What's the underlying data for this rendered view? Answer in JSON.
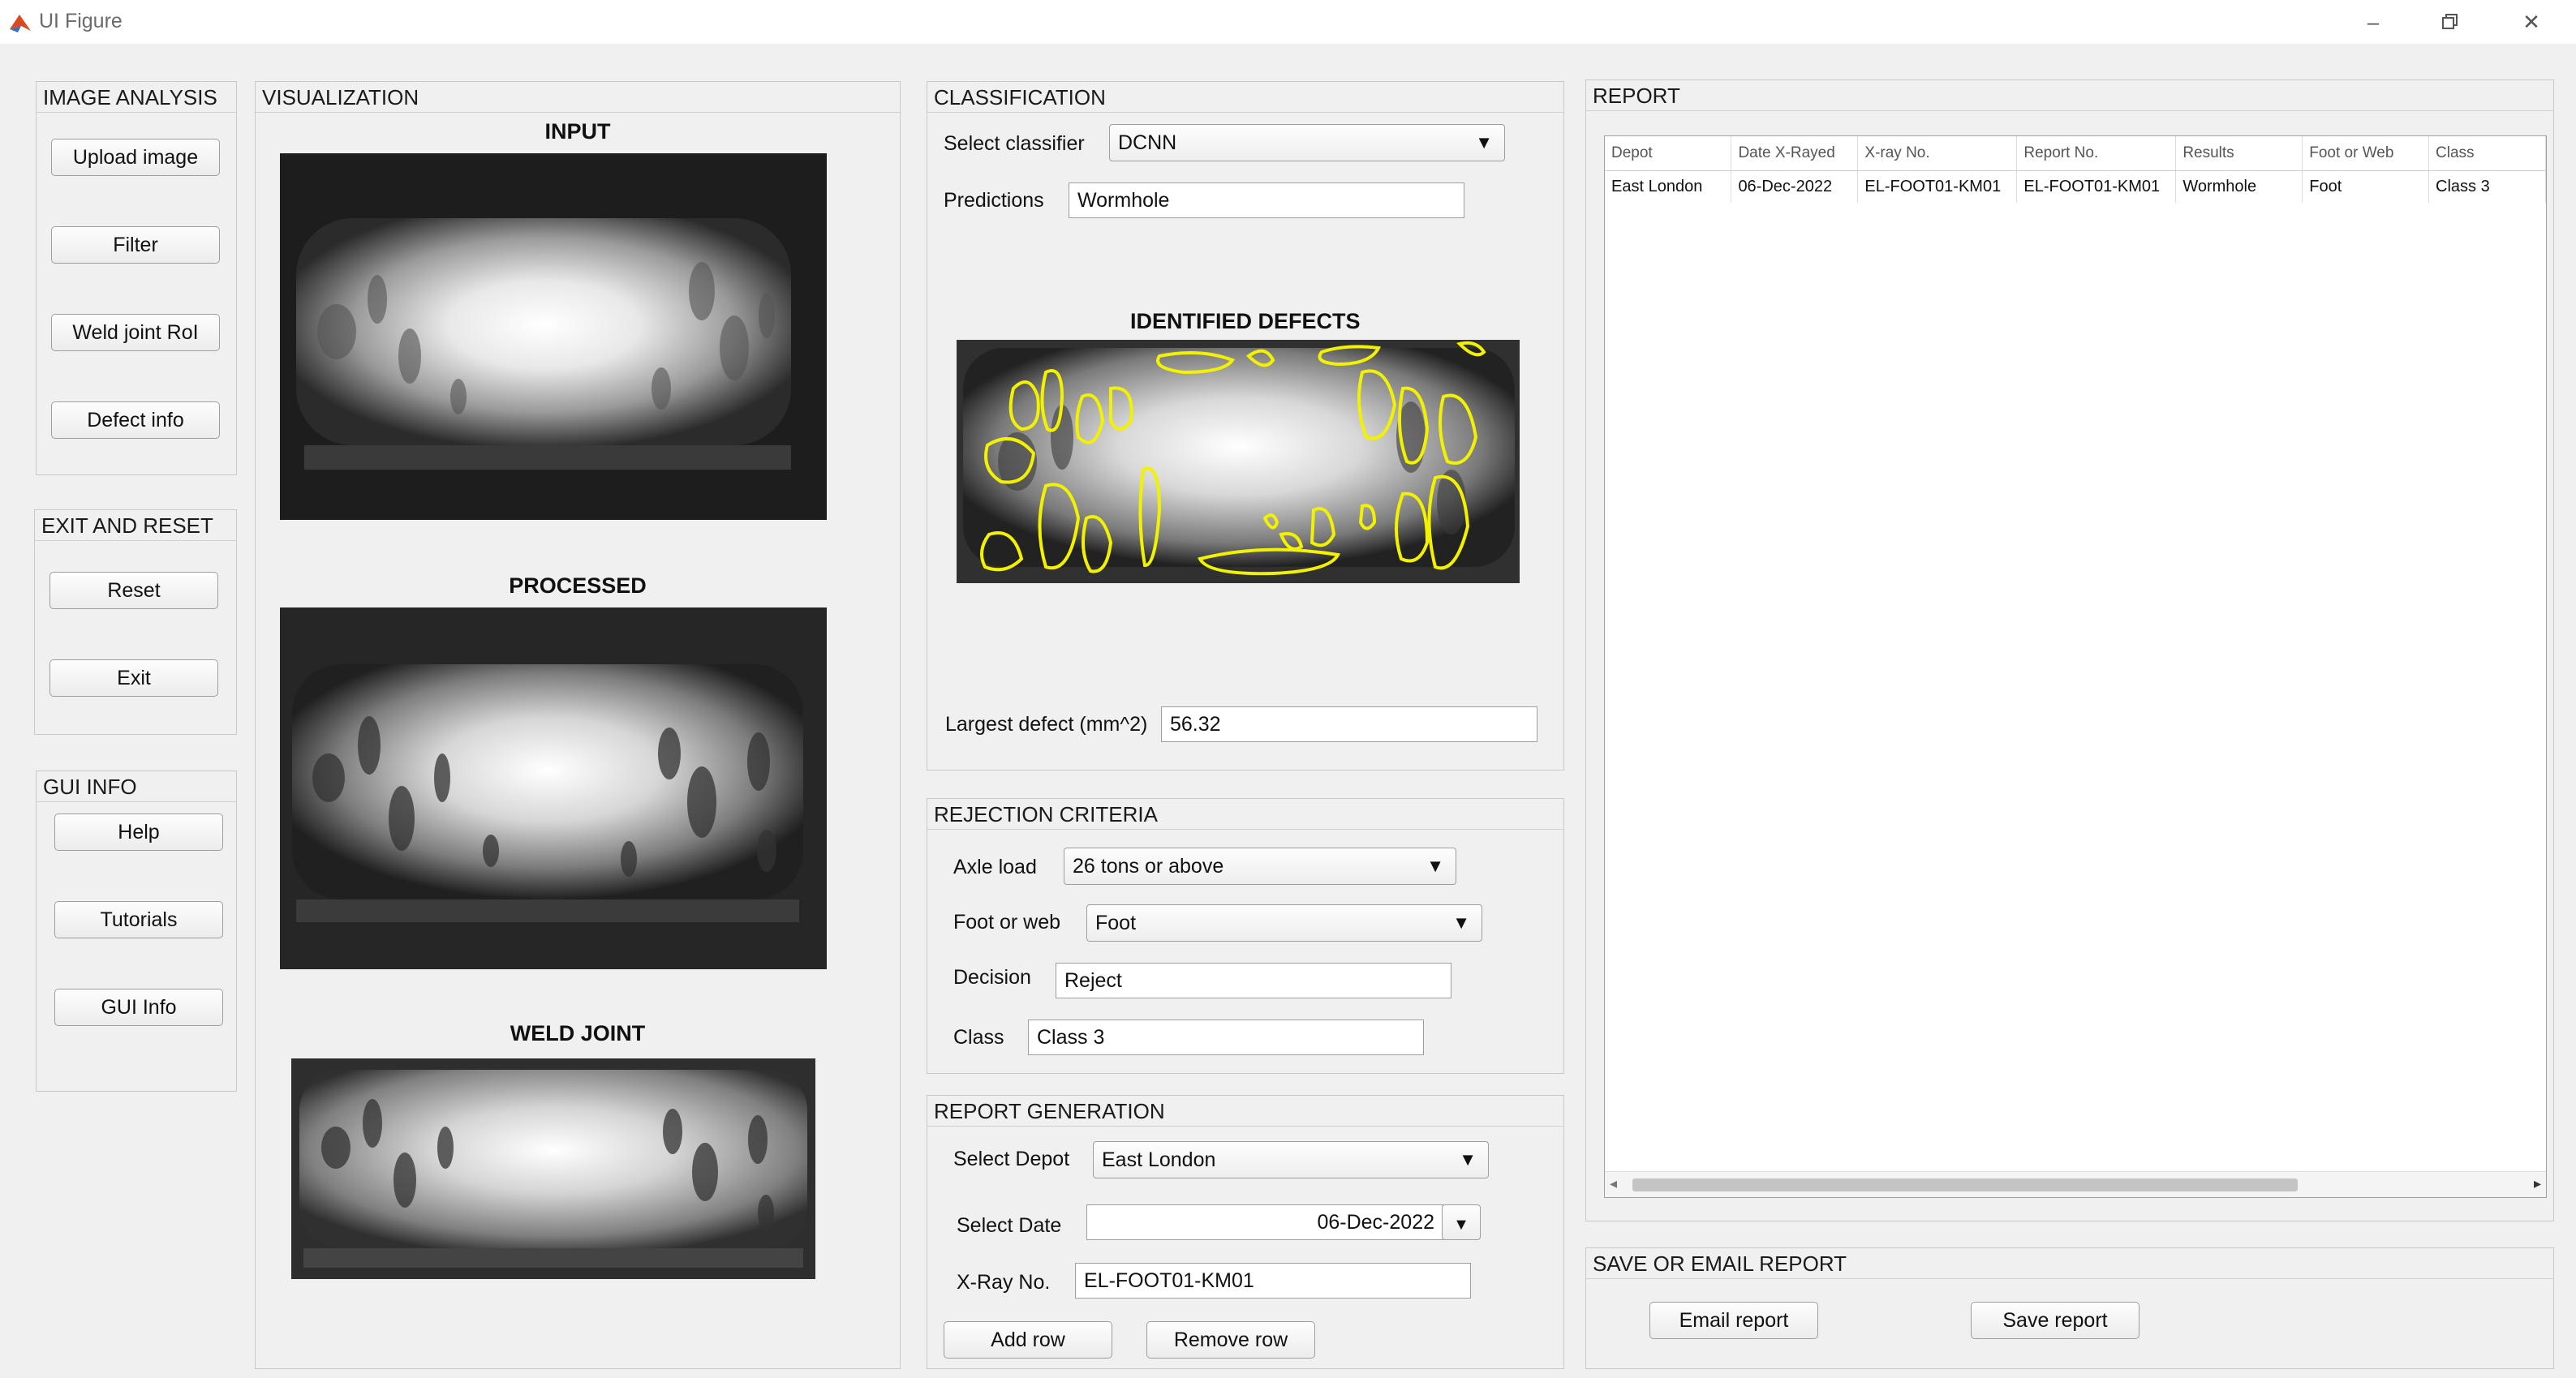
{
  "window": {
    "title": "UI Figure"
  },
  "image_analysis": {
    "title": "IMAGE ANALYSIS",
    "buttons": [
      "Upload image",
      "Filter",
      "Weld  joint RoI",
      "Defect info"
    ]
  },
  "exit_reset": {
    "title": "EXIT AND RESET",
    "buttons": [
      "Reset",
      "Exit"
    ]
  },
  "gui_info": {
    "title": "GUI INFO",
    "buttons": [
      "Help",
      "Tutorials",
      "GUI Info"
    ]
  },
  "visualization": {
    "title": "VISUALIZATION",
    "input_title": "INPUT",
    "processed_title": "PROCESSED",
    "weld_title": "WELD JOINT"
  },
  "classification": {
    "title": "CLASSIFICATION",
    "classifier_label": "Select classifier",
    "classifier_value": "DCNN",
    "predictions_label": "Predictions",
    "predictions_value": "Wormhole",
    "defects_title": "IDENTIFIED DEFECTS",
    "largest_label": "Largest defect (mm^2)",
    "largest_value": "56.32"
  },
  "rejection": {
    "title": "REJECTION CRITERIA",
    "axle_label": "Axle load",
    "axle_value": "26 tons or above",
    "foot_label": "Foot or web",
    "foot_value": "Foot",
    "decision_label": "Decision",
    "decision_value": "Reject",
    "class_label": "Class",
    "class_value": "Class 3"
  },
  "report_generation": {
    "title": "REPORT GENERATION",
    "depot_label": "Select Depot",
    "depot_value": "East London",
    "date_label": "Select Date",
    "date_value": "06-Dec-2022",
    "xray_label": "X-Ray No.",
    "xray_value": "EL-FOOT01-KM01",
    "add_row": "Add row",
    "remove_row": "Remove row"
  },
  "report": {
    "title": "REPORT",
    "columns": [
      "Depot",
      "Date X-Rayed",
      "X-ray No.",
      "Report No.",
      "Results",
      "Foot or Web",
      "Class"
    ],
    "rows": [
      [
        "East London",
        "06-Dec-2022",
        "EL-FOOT01-KM01",
        "EL-FOOT01-KM01",
        "Wormhole",
        "Foot",
        "Class 3"
      ]
    ]
  },
  "save_email": {
    "title": "SAVE OR EMAIL REPORT",
    "email": "Email report",
    "save": "Save report"
  },
  "colors": {
    "defect_outline": "#f2f200",
    "panel_bg": "#f0f0f0",
    "border": "#c8c8c8"
  }
}
